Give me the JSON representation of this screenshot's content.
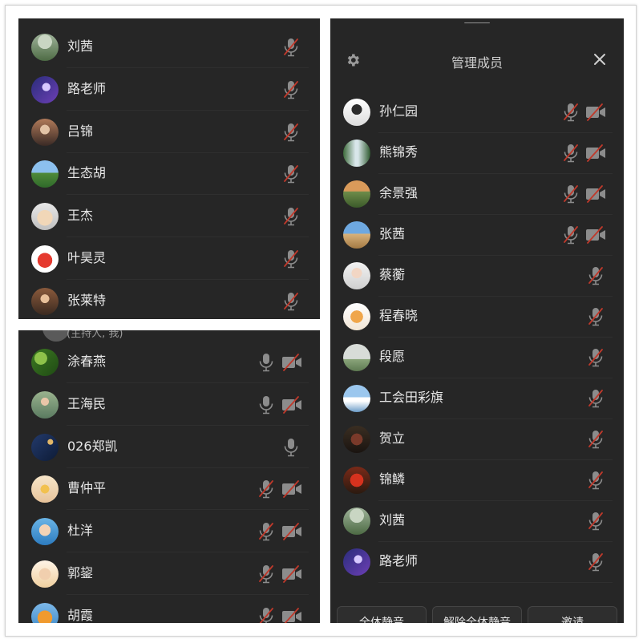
{
  "panel_a": {
    "members": [
      {
        "name": "刘茜",
        "avatar": "av-trees",
        "mic": "off",
        "cam": "none"
      },
      {
        "name": "路老师",
        "avatar": "av-purple",
        "mic": "off",
        "cam": "none"
      },
      {
        "name": "吕锦",
        "avatar": "av-person-dark",
        "mic": "off",
        "cam": "none"
      },
      {
        "name": "生态胡",
        "avatar": "av-field",
        "mic": "off",
        "cam": "none"
      },
      {
        "name": "王杰",
        "avatar": "av-cartoon",
        "mic": "off",
        "cam": "none"
      },
      {
        "name": "叶昊灵",
        "avatar": "av-red-bird",
        "mic": "off",
        "cam": "none"
      },
      {
        "name": "张莱特",
        "avatar": "av-person-warm",
        "mic": "off",
        "cam": "none"
      }
    ]
  },
  "panel_b": {
    "partial_label": "(主持人, 我)",
    "members": [
      {
        "name": "涂春燕",
        "avatar": "av-leaves",
        "mic": "on",
        "cam": "off"
      },
      {
        "name": "王海民",
        "avatar": "av-kid",
        "mic": "on",
        "cam": "off"
      },
      {
        "name": "026郑凯",
        "avatar": "av-space",
        "mic": "on",
        "cam": "none"
      },
      {
        "name": "曹仲平",
        "avatar": "av-star",
        "mic": "off",
        "cam": "off"
      },
      {
        "name": "杜洋",
        "avatar": "av-boy",
        "mic": "off",
        "cam": "off"
      },
      {
        "name": "郭鋆",
        "avatar": "av-cartoon-girl",
        "mic": "off",
        "cam": "off"
      },
      {
        "name": "胡霞",
        "avatar": "av-tiger",
        "mic": "off",
        "cam": "off"
      }
    ]
  },
  "panel_c": {
    "title": "管理成员",
    "members": [
      {
        "name": "孙仁园",
        "avatar": "av-girl-white",
        "mic": "off",
        "cam": "off"
      },
      {
        "name": "熊锦秀",
        "avatar": "av-waterfall",
        "mic": "off",
        "cam": "off"
      },
      {
        "name": "余景强",
        "avatar": "av-mountain",
        "mic": "off",
        "cam": "off"
      },
      {
        "name": "张茜",
        "avatar": "av-desert",
        "mic": "off",
        "cam": "off"
      },
      {
        "name": "蔡蘅",
        "avatar": "av-woman",
        "mic": "off",
        "cam": "none"
      },
      {
        "name": "程春晓",
        "avatar": "av-bear",
        "mic": "off",
        "cam": "none"
      },
      {
        "name": "段愿",
        "avatar": "av-tent",
        "mic": "off",
        "cam": "none"
      },
      {
        "name": "工会田彩旗",
        "avatar": "av-sky",
        "mic": "off",
        "cam": "none"
      },
      {
        "name": "贺立",
        "avatar": "av-hands",
        "mic": "off",
        "cam": "none"
      },
      {
        "name": "锦鳞",
        "avatar": "av-red-flowers",
        "mic": "off",
        "cam": "none"
      },
      {
        "name": "刘茜",
        "avatar": "av-trees",
        "mic": "off",
        "cam": "none"
      },
      {
        "name": "路老师",
        "avatar": "av-purple",
        "mic": "off",
        "cam": "none"
      }
    ],
    "buttons": {
      "mute_all": "全体静音",
      "unmute_all": "解除全体静音",
      "invite": "邀请"
    }
  },
  "colors": {
    "panel_bg": "#262626",
    "text": "#e8e8e8",
    "icon": "#8c8c8c",
    "muted_slash": "#c0392b"
  }
}
